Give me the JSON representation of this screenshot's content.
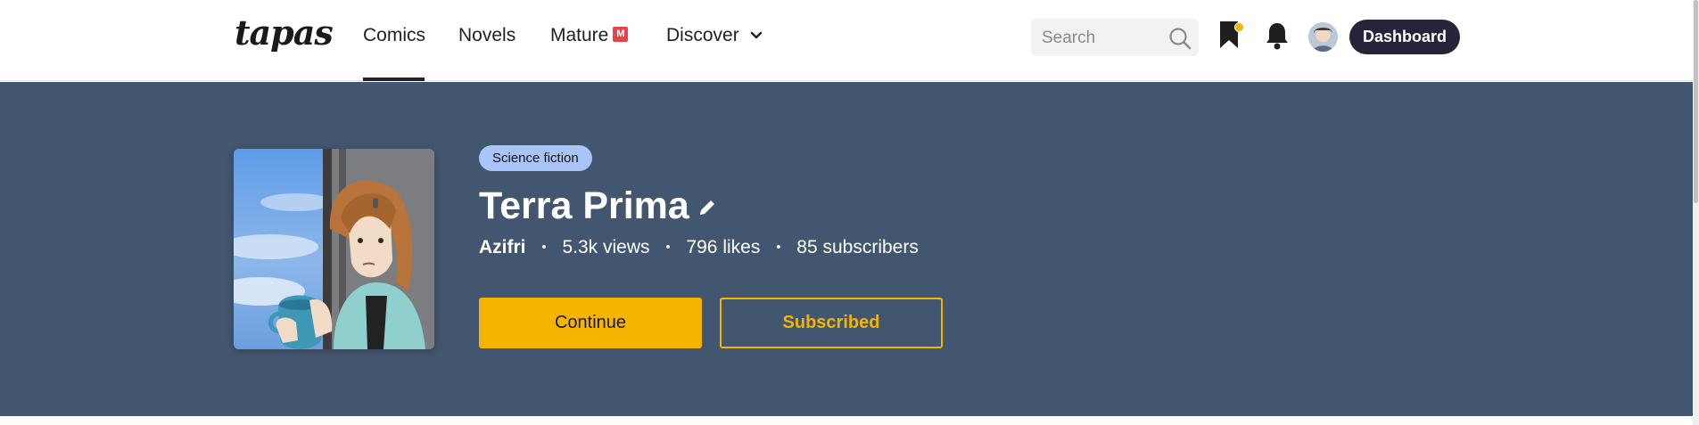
{
  "brand": {
    "logo_text": "tapas"
  },
  "nav": {
    "items": [
      {
        "label": "Comics",
        "active": true
      },
      {
        "label": "Novels",
        "active": false
      },
      {
        "label": "Mature",
        "badge": "M",
        "active": false
      },
      {
        "label": "Discover",
        "has_dropdown": true,
        "active": false
      }
    ]
  },
  "search": {
    "placeholder": "Search",
    "icon": "search-icon"
  },
  "header_actions": {
    "library_icon": "bookmark-icon",
    "notification_icon": "bell-icon",
    "has_new_library_item": true,
    "dashboard_label": "Dashboard"
  },
  "series": {
    "genre": "Science fiction",
    "title": "Terra Prima",
    "author": "Azifri",
    "views": "5.3k views",
    "likes": "796 likes",
    "subscribers": "85 subscribers",
    "continue_label": "Continue",
    "subscribed_label": "Subscribed"
  },
  "colors": {
    "hero_bg": "#43566f",
    "accent": "#f5b400",
    "genre_pill": "#a9c4f7",
    "dashboard_bg": "#26243a",
    "mature_badge": "#e8424a"
  }
}
